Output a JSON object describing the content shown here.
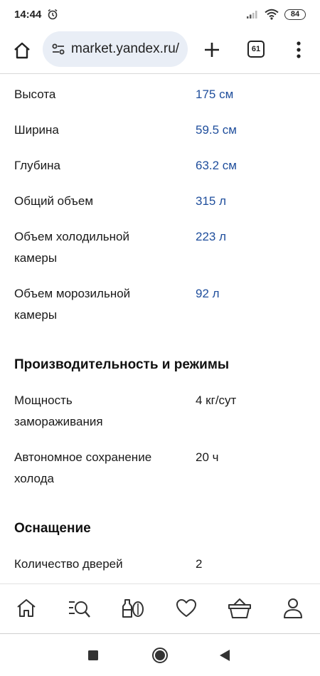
{
  "status_bar": {
    "time": "14:44",
    "battery": "84",
    "icons": [
      "alarm-icon",
      "signal-icon",
      "wifi-icon",
      "battery-icon"
    ]
  },
  "browser": {
    "url": "market.yandex.ru/",
    "tab_count": "61"
  },
  "specs_dimensions": [
    {
      "name": "Высота",
      "value": "175 см"
    },
    {
      "name": "Ширина",
      "value": "59.5 см"
    },
    {
      "name": "Глубина",
      "value": "63.2 см"
    },
    {
      "name": "Общий объем",
      "value": "315 л"
    },
    {
      "name": "Объем холодильной камеры",
      "value": "223 л"
    },
    {
      "name": "Объем морозильной камеры",
      "value": "92 л"
    }
  ],
  "section_performance": {
    "title": "Производительность и режимы",
    "specs": [
      {
        "name": "Мощность замораживания",
        "value": "4 кг/сут"
      },
      {
        "name": "Автономное сохранение холода",
        "value": "20 ч"
      }
    ]
  },
  "section_equipment": {
    "title": "Оснащение",
    "specs": [
      {
        "name": "Количество дверей",
        "value": "2"
      }
    ]
  },
  "bottom_nav": [
    "home-icon",
    "catalog-search-icon",
    "products-icon",
    "favorites-icon",
    "cart-icon",
    "profile-icon"
  ],
  "colors": {
    "link": "#1f4e9c",
    "url_bar_bg": "#e9eef6"
  }
}
